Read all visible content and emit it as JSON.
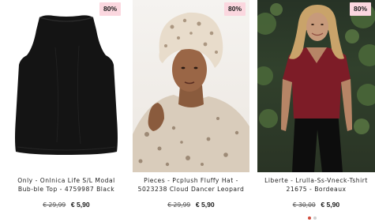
{
  "products": [
    {
      "badge": "80%",
      "title": "Only - Onlnica Life S/L Modal Bub-ble Top - 4759987 Black",
      "old_price": "€ 29,99",
      "new_price": "€ 5,90"
    },
    {
      "badge": "80%",
      "title": "Pieces - Pcplush Fluffy Hat - 5023238 Cloud Dancer Leopard",
      "old_price": "€ 29,99",
      "new_price": "€ 5,90"
    },
    {
      "badge": "80%",
      "title": "Liberte - Lrulla-Ss-Vneck-Tshirt 21675 - Bordeaux",
      "old_price": "€ 30,00",
      "new_price": "€ 5,90"
    }
  ],
  "pagination": {
    "active_index": 0,
    "count": 2
  },
  "colors": {
    "badge_bg": "#fbd7df",
    "active_dot": "#d14b3c",
    "inactive_dot": "#cfcfcf"
  }
}
